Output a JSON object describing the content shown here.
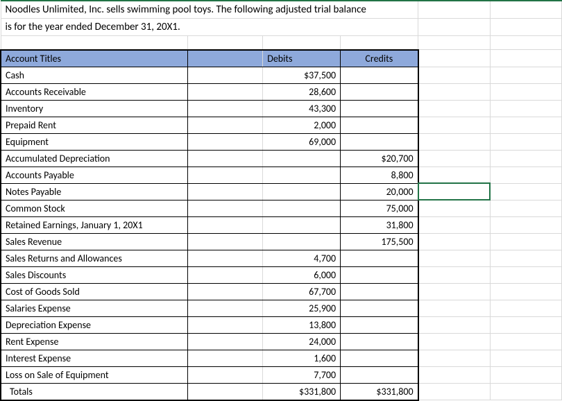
{
  "intro": {
    "line1": "Noodles Unlimited, Inc. sells swimming pool toys.  The following adjusted trial balance",
    "line2": "is for the year ended December 31, 20X1."
  },
  "headers": {
    "account": "Account Titles",
    "debits": "Debits",
    "credits": "Credits"
  },
  "rows": [
    {
      "title": "Cash",
      "debit": "$37,500",
      "credit": ""
    },
    {
      "title": "Accounts Receivable",
      "debit": "28,600",
      "credit": ""
    },
    {
      "title": "Inventory",
      "debit": "43,300",
      "credit": ""
    },
    {
      "title": "Prepaid Rent",
      "debit": "2,000",
      "credit": ""
    },
    {
      "title": "Equipment",
      "debit": "69,000",
      "credit": ""
    },
    {
      "title": "Accumulated Depreciation",
      "debit": "",
      "credit": "$20,700"
    },
    {
      "title": "Accounts Payable",
      "debit": "",
      "credit": "8,800"
    },
    {
      "title": "Notes Payable",
      "debit": "",
      "credit": "20,000"
    },
    {
      "title": "Common Stock",
      "debit": "",
      "credit": "75,000"
    },
    {
      "title": "Retained Earnings, January 1, 20X1",
      "debit": "",
      "credit": "31,800"
    },
    {
      "title": "Sales Revenue",
      "debit": "",
      "credit": "175,500"
    },
    {
      "title": "Sales Returns and Allowances",
      "debit": "4,700",
      "credit": ""
    },
    {
      "title": "Sales Discounts",
      "debit": "6,000",
      "credit": ""
    },
    {
      "title": "Cost of Goods Sold",
      "debit": "67,700",
      "credit": ""
    },
    {
      "title": "Salaries Expense",
      "debit": "25,900",
      "credit": ""
    },
    {
      "title": "Depreciation Expense",
      "debit": "13,800",
      "credit": ""
    },
    {
      "title": "Rent Expense",
      "debit": "24,000",
      "credit": ""
    },
    {
      "title": "Interest Expense",
      "debit": "1,600",
      "credit": ""
    },
    {
      "title": "Loss on Sale of Equipment",
      "debit": "7,700",
      "credit": ""
    }
  ],
  "totals": {
    "title": "Totals",
    "debit": "$331,800",
    "credit": "$331,800"
  },
  "chart_data": {
    "type": "table",
    "title": "Adjusted Trial Balance — Noodles Unlimited, Inc. — Year Ended December 31, 20X1",
    "columns": [
      "Account Titles",
      "Debits",
      "Credits"
    ],
    "rows": [
      [
        "Cash",
        37500,
        null
      ],
      [
        "Accounts Receivable",
        28600,
        null
      ],
      [
        "Inventory",
        43300,
        null
      ],
      [
        "Prepaid Rent",
        2000,
        null
      ],
      [
        "Equipment",
        69000,
        null
      ],
      [
        "Accumulated Depreciation",
        null,
        20700
      ],
      [
        "Accounts Payable",
        null,
        8800
      ],
      [
        "Notes Payable",
        null,
        20000
      ],
      [
        "Common Stock",
        null,
        75000
      ],
      [
        "Retained Earnings, January 1, 20X1",
        null,
        31800
      ],
      [
        "Sales Revenue",
        null,
        175500
      ],
      [
        "Sales Returns and Allowances",
        4700,
        null
      ],
      [
        "Sales Discounts",
        6000,
        null
      ],
      [
        "Cost of Goods Sold",
        67700,
        null
      ],
      [
        "Salaries Expense",
        25900,
        null
      ],
      [
        "Depreciation Expense",
        13800,
        null
      ],
      [
        "Rent Expense",
        24000,
        null
      ],
      [
        "Interest Expense",
        1600,
        null
      ],
      [
        "Loss on Sale of Equipment",
        7700,
        null
      ],
      [
        "Totals",
        331800,
        331800
      ]
    ]
  }
}
